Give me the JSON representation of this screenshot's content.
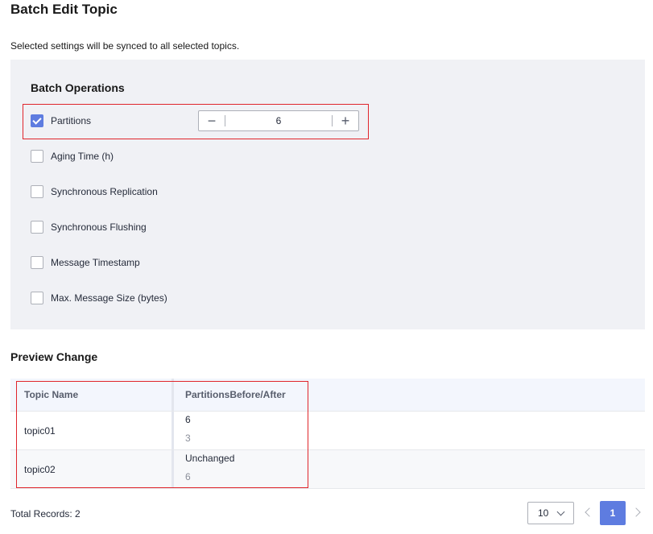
{
  "page": {
    "title": "Batch Edit Topic",
    "subtitle": "Selected settings will be synced to all selected topics."
  },
  "batch_operations": {
    "heading": "Batch Operations",
    "items": [
      {
        "label": "Partitions",
        "checked": true
      },
      {
        "label": "Aging Time (h)",
        "checked": false
      },
      {
        "label": "Synchronous Replication",
        "checked": false
      },
      {
        "label": "Synchronous Flushing",
        "checked": false
      },
      {
        "label": "Message Timestamp",
        "checked": false
      },
      {
        "label": "Max. Message Size (bytes)",
        "checked": false
      }
    ],
    "partitions_stepper": {
      "value": "6",
      "decrement_icon": "minus-icon",
      "increment_icon": "plus-icon"
    }
  },
  "preview": {
    "heading": "Preview Change",
    "columns": [
      "Topic Name",
      "PartitionsBefore/After"
    ],
    "rows": [
      {
        "topic": "topic01",
        "after": "6",
        "before": "3"
      },
      {
        "topic": "topic02",
        "after": "Unchanged",
        "before": "6"
      }
    ]
  },
  "pagination": {
    "total_records": "Total Records: 2",
    "page_size": "10",
    "current_page": "1",
    "prev_icon": "chevron-left-icon",
    "next_icon": "chevron-right-icon",
    "page_size_icon": "chevron-down-icon"
  },
  "colors": {
    "accent": "#5e7ce0",
    "highlight": "#e0252b",
    "panel_bg": "#f0f1f5"
  }
}
